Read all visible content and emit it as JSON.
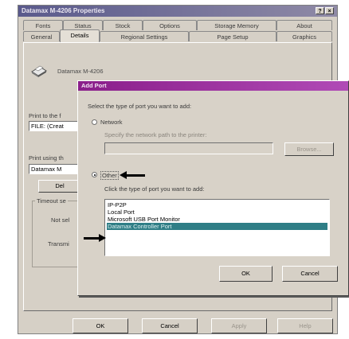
{
  "window": {
    "title": "Datamax M-4206 Properties",
    "close_glyph": "×"
  },
  "tabs_row1": [
    "Fonts",
    "Status",
    "Stock",
    "Options",
    "Storage Memory",
    "About"
  ],
  "tabs_row2": [
    "General",
    "Details",
    "Regional Settings",
    "Page Setup",
    "Graphics"
  ],
  "printer_name": "Datamax M-4206",
  "left_labels": {
    "print_to": "Print to the f",
    "print_to_value": "FILE: (Creat",
    "print_using": "Print using th",
    "print_using_value": "Datamax M",
    "button_cut": "Del",
    "timeout": "Timeout se",
    "not_sel": "Not sel",
    "transm": "Transmi"
  },
  "main_buttons": {
    "ok": "OK",
    "cancel": "Cancel",
    "apply": "Apply",
    "help": "Help"
  },
  "dialog": {
    "title": "Add Port",
    "prompt": "Select the type of port you want to add:",
    "network_label": "Network",
    "network_hint": "Specify the network path to the printer:",
    "browse_label": "Browse...",
    "other_label": "Other",
    "other_hint": "Click the type of port you want to add:",
    "port_types": [
      "IP-P2P",
      "Local Port",
      "Microsoft USB Port Monitor",
      "Datamax Controller Port"
    ],
    "selected_port_index": 3,
    "ok": "OK",
    "cancel": "Cancel"
  }
}
